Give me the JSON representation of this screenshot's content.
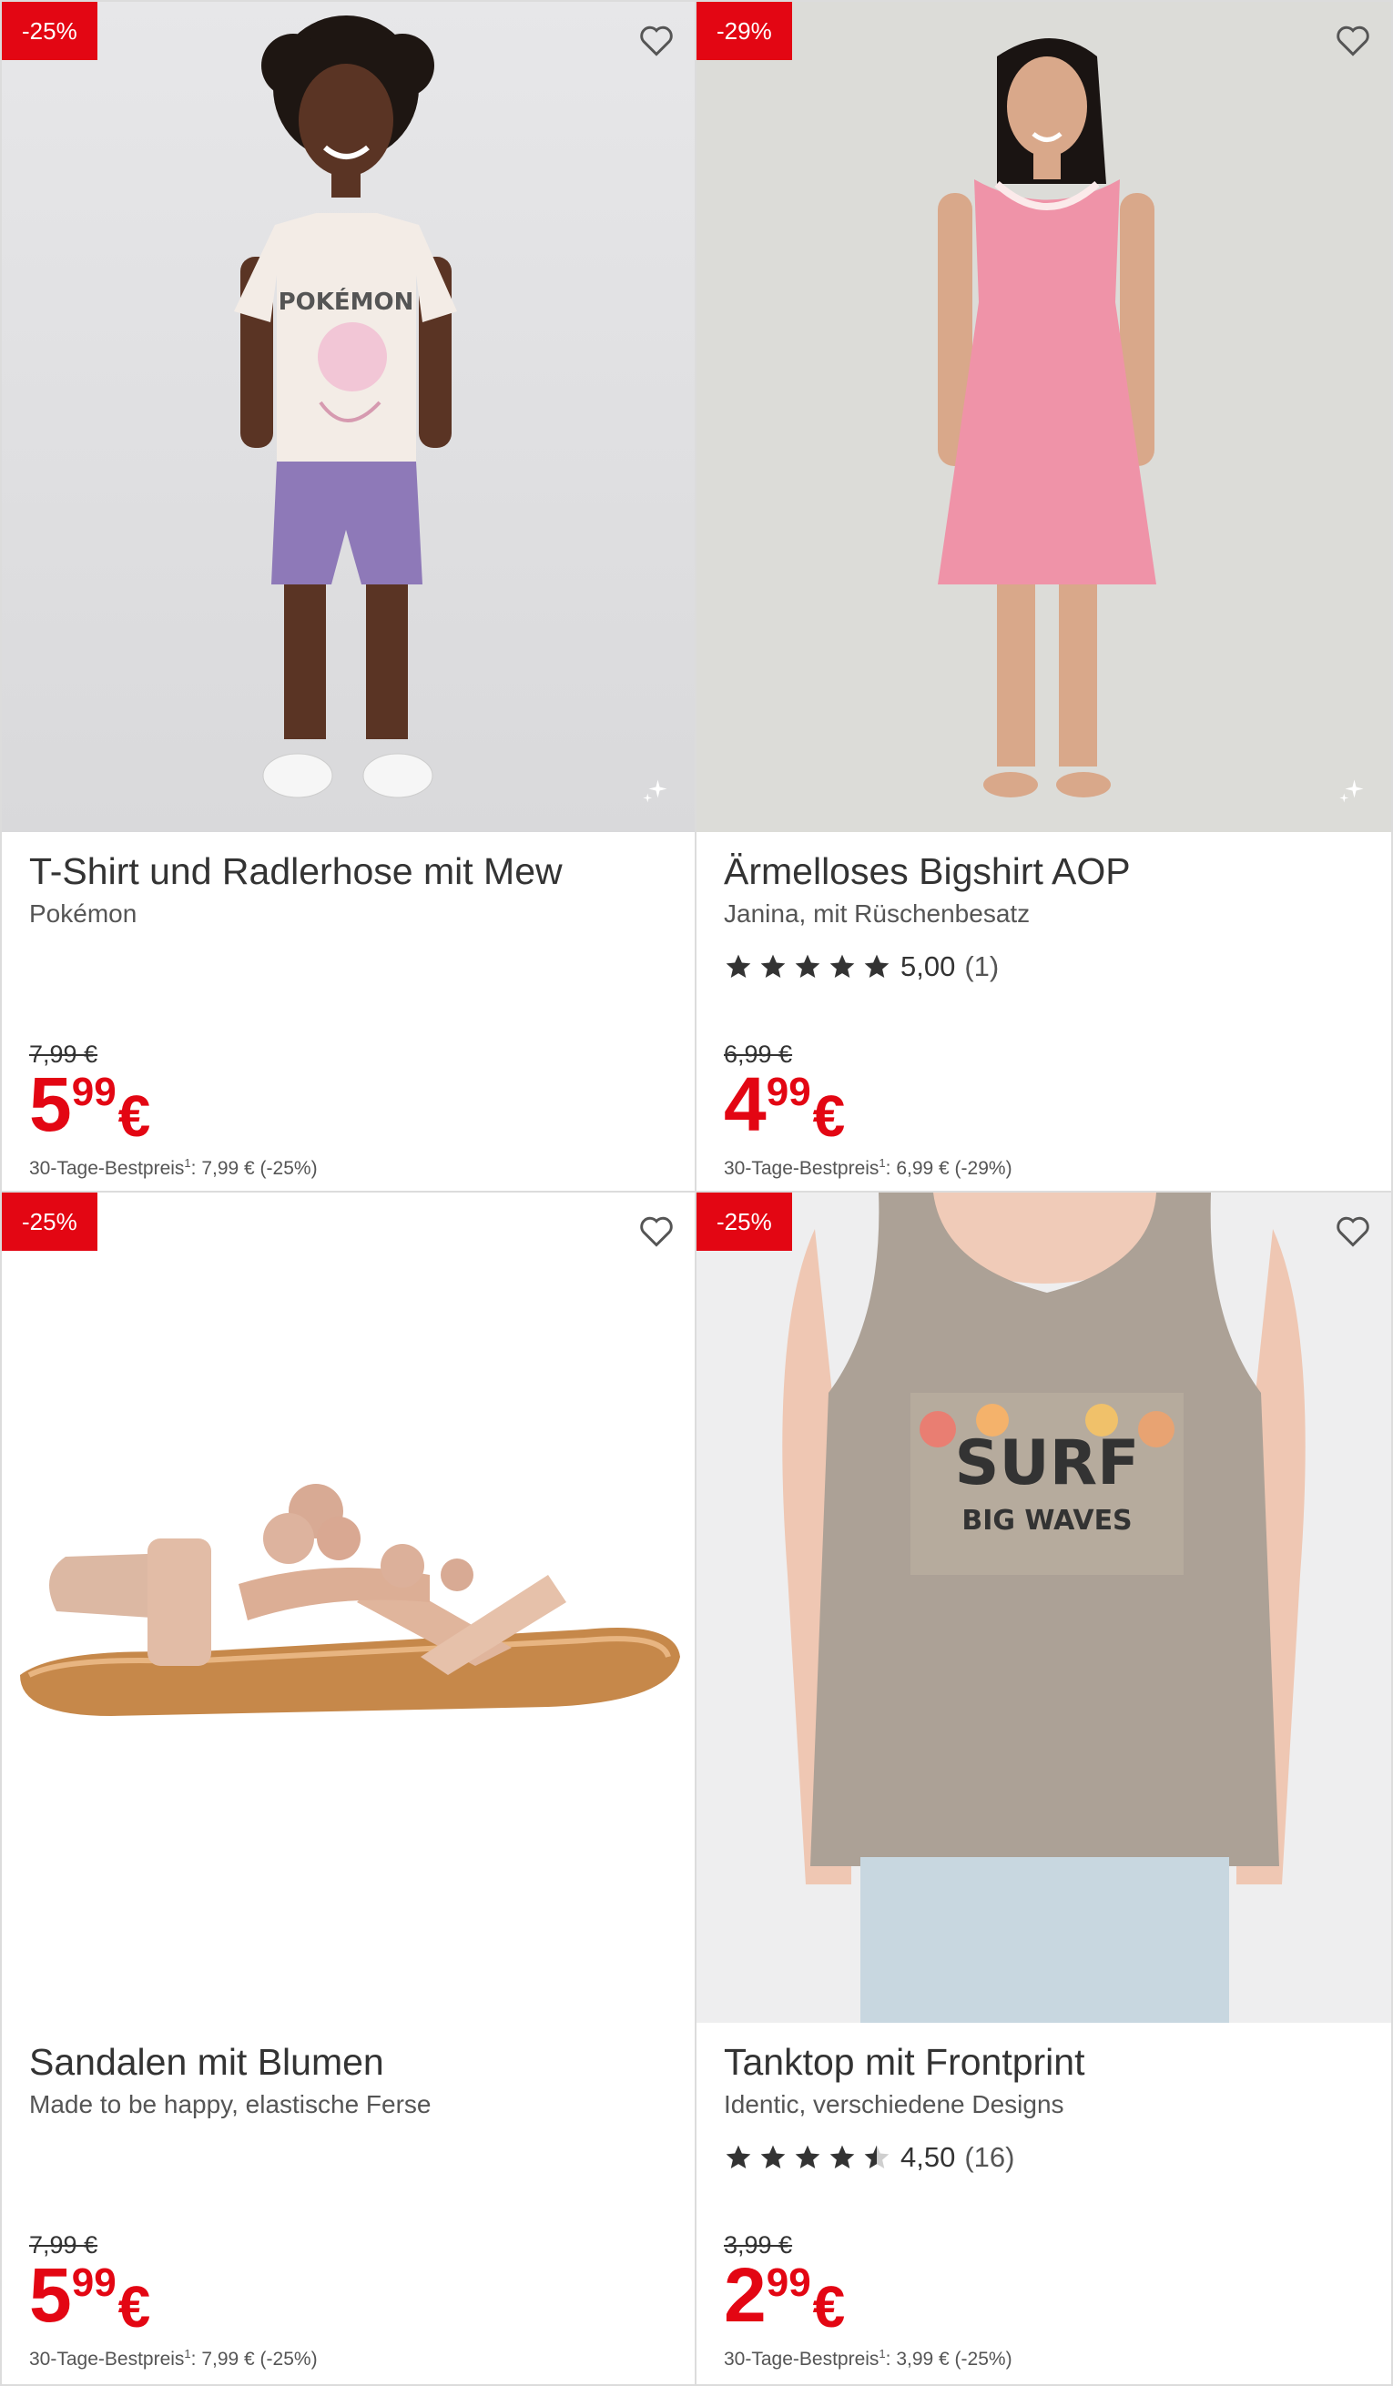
{
  "products": [
    {
      "badge": "-25%",
      "title": "T-Shirt und Radlerhose mit Mew",
      "subtitle": "Pokémon",
      "rating": null,
      "old_price": "7,99 €",
      "price_int": "5",
      "price_dec": "99",
      "currency": "€",
      "best_label": "30-Tage-Bestpreis",
      "best_sup": "1",
      "best_value": ": 7,99 € (-25%)",
      "image": "child-pokemon-outfit"
    },
    {
      "badge": "-29%",
      "title": "Ärmelloses Bigshirt AOP",
      "subtitle": "Janina, mit Rüschenbesatz",
      "rating": {
        "stars": 5,
        "value": "5,00",
        "count": "(1)"
      },
      "old_price": "6,99 €",
      "price_int": "4",
      "price_dec": "99",
      "currency": "€",
      "best_label": "30-Tage-Bestpreis",
      "best_sup": "1",
      "best_value": ": 6,99 € (-29%)",
      "image": "woman-pink-nightdress"
    },
    {
      "badge": "-25%",
      "title": "Sandalen mit Blumen",
      "subtitle": "Made to be happy, elastische Ferse",
      "rating": null,
      "old_price": "7,99 €",
      "price_int": "5",
      "price_dec": "99",
      "currency": "€",
      "best_label": "30-Tage-Bestpreis",
      "best_sup": "1",
      "best_value": ": 7,99 € (-25%)",
      "image": "flower-sandal"
    },
    {
      "badge": "-25%",
      "title": "Tanktop mit Frontprint",
      "subtitle": "Identic, verschiedene Designs",
      "rating": {
        "stars": 4.5,
        "value": "4,50",
        "count": "(16)"
      },
      "old_price": "3,99 €",
      "price_int": "2",
      "price_dec": "99",
      "currency": "€",
      "best_label": "30-Tage-Bestpreis",
      "best_sup": "1",
      "best_value": ": 3,99 € (-25%)",
      "image": "man-surf-tanktop",
      "print_text": [
        "SURF",
        "BIG WAVES"
      ]
    }
  ],
  "icons": {
    "wishlist": "heart-outline-icon",
    "ai": "sparkle-icon",
    "star": "star-icon"
  },
  "colors": {
    "accent": "#e30613",
    "text": "#333333",
    "muted": "#555555",
    "border": "#dcdcdc"
  }
}
